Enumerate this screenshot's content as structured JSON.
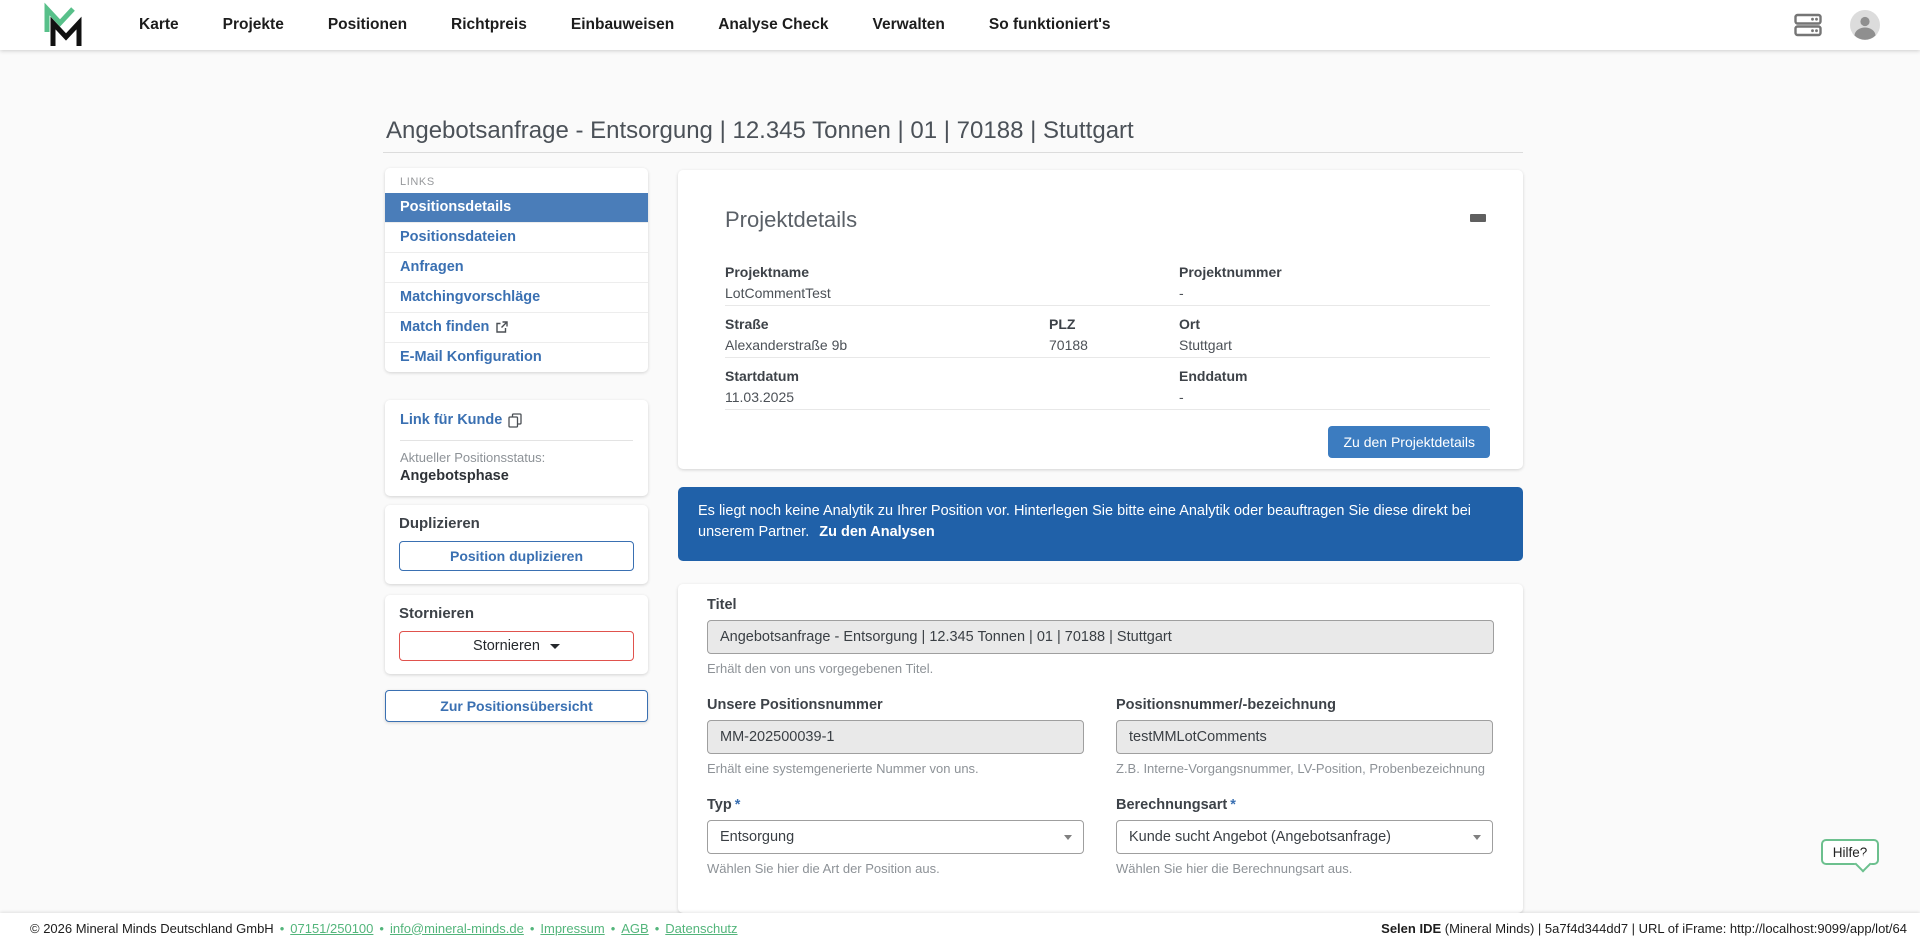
{
  "nav": {
    "items": [
      "Karte",
      "Projekte",
      "Positionen",
      "Richtpreis",
      "Einbauweisen",
      "Analyse Check",
      "Verwalten",
      "So funktioniert's"
    ]
  },
  "page": {
    "title": "Angebotsanfrage - Entsorgung | 12.345 Tonnen | 01 | 70188 | Stuttgart"
  },
  "sidebar": {
    "links_card": {
      "heading": "LINKS",
      "items": [
        {
          "label": "Positionsdetails"
        },
        {
          "label": "Positionsdateien"
        },
        {
          "label": "Anfragen"
        },
        {
          "label": "Matchingvorschläge"
        },
        {
          "label": "Match finden"
        },
        {
          "label": "E-Mail Konfiguration"
        }
      ]
    },
    "customer_card": {
      "link_label": "Link für Kunde",
      "status_label": "Aktueller Positionsstatus:",
      "status_value": "Angebotsphase"
    },
    "duplicate_card": {
      "heading": "Duplizieren",
      "button_label": "Position duplizieren"
    },
    "cancel_card": {
      "heading": "Stornieren",
      "button_label": "Stornieren"
    },
    "overview_button_label": "Zur Positionsübersicht"
  },
  "project_details": {
    "title": "Projektdetails",
    "projektname_label": "Projektname",
    "projektname_value": "LotCommentTest",
    "projektnummer_label": "Projektnummer",
    "projektnummer_value": "-",
    "strasse_label": "Straße",
    "strasse_value": "Alexanderstraße 9b",
    "plz_label": "PLZ",
    "plz_value": "70188",
    "ort_label": "Ort",
    "ort_value": "Stuttgart",
    "startdatum_label": "Startdatum",
    "startdatum_value": "11.03.2025",
    "enddatum_label": "Enddatum",
    "enddatum_value": "-",
    "button_label": "Zu den Projektdetails"
  },
  "alert": {
    "text": "Es liegt noch keine Analytik zu Ihrer Position vor. Hinterlegen Sie bitte eine Analytik oder beauftragen Sie diese direkt bei unserem Partner.",
    "link_label": "Zu den Analysen"
  },
  "form": {
    "titel": {
      "label": "Titel",
      "value": "Angebotsanfrage - Entsorgung | 12.345 Tonnen | 01 | 70188 | Stuttgart",
      "helper": "Erhält den von uns vorgegebenen Titel."
    },
    "positionsnummer": {
      "label": "Unsere Positionsnummer",
      "value": "MM-202500039-1",
      "helper": "Erhält eine systemgenerierte Nummer von uns."
    },
    "bezeichnung": {
      "label": "Positionsnummer/-bezeichnung",
      "value": "testMMLotComments",
      "helper": "Z.B. Interne-Vorgangsnummer, LV-Position, Probenbezeichnung"
    },
    "typ": {
      "label": "Typ",
      "required": "*",
      "value": "Entsorgung",
      "helper": "Wählen Sie hier die Art der Position aus."
    },
    "berechnungsart": {
      "label": "Berechnungsart",
      "required": "*",
      "value": "Kunde sucht Angebot (Angebotsanfrage)",
      "helper": "Wählen Sie hier die Berechnungsart aus."
    }
  },
  "help_button_label": "Hilfe?",
  "footer": {
    "copyright": "© 2026 Mineral Minds Deutschland GmbH",
    "links": [
      "07151/250100",
      "info@mineral-minds.de",
      "Impressum",
      "AGB",
      "Datenschutz"
    ],
    "right_bold": "Selen IDE",
    "right_rest": " (Mineral Minds) | 5a7f4d344dd7 | URL of iFrame: http://localhost:9099/app/lot/64"
  },
  "colors": {
    "accent_blue": "#3a70b2",
    "active_item_blue": "#4a7db9",
    "button_blue": "#3c7cc0",
    "alert_blue": "#2061a9",
    "danger_red": "#e0524d",
    "footer_link_green": "#53b57b",
    "logo_green": "#58c08a",
    "help_border_green": "#6cc08e"
  }
}
